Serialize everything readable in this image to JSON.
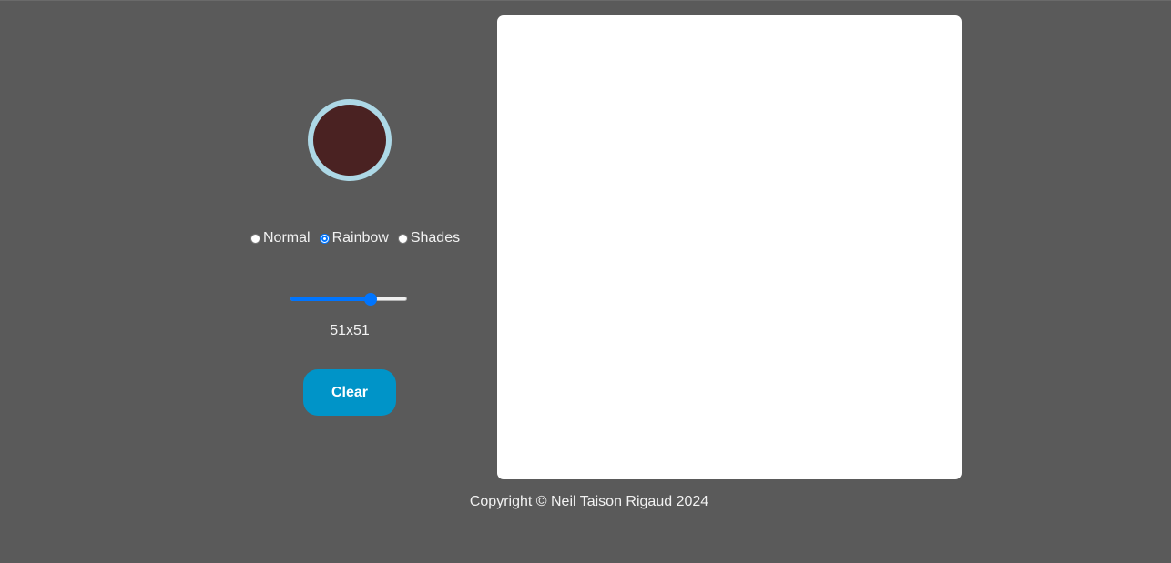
{
  "color_picker": {
    "current_color": "#4a2222",
    "ring_color": "#add8e6"
  },
  "modes": {
    "options": [
      {
        "label": "Normal",
        "checked": false
      },
      {
        "label": "Rainbow",
        "checked": true
      },
      {
        "label": "Shades",
        "checked": false
      }
    ],
    "selected": "Rainbow"
  },
  "grid_slider": {
    "fraction": 0.71,
    "accent_color": "#0075ff"
  },
  "grid_size_label": "51x51",
  "clear_button": {
    "label": "Clear",
    "color": "#0094c8"
  },
  "canvas": {
    "background": "#ffffff"
  },
  "footer": {
    "text": "Copyright © Neil Taison Rigaud 2024"
  }
}
